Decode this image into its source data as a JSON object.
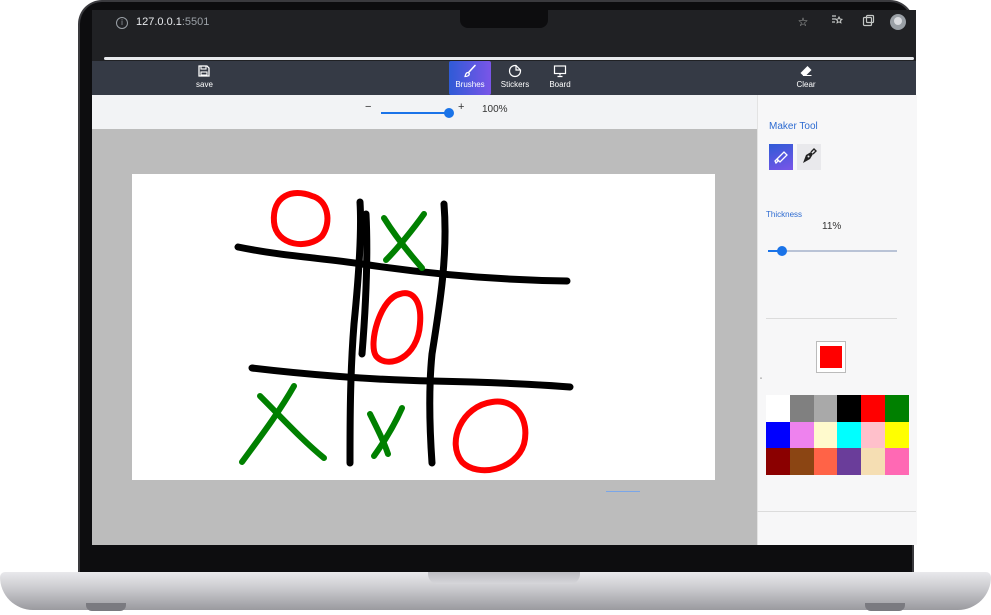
{
  "browser": {
    "url_host": "127.0.0.1",
    "url_port": ":5501",
    "icons": [
      "info-icon",
      "star-icon",
      "bookmarks-icon",
      "extensions-icon",
      "profile-avatar"
    ]
  },
  "toolbar": {
    "save_label": "save",
    "brushes_label": "Brushes",
    "stickers_label": "Stickers",
    "board_label": "Board",
    "clear_label": "Clear",
    "active_tab": "Brushes"
  },
  "zoom": {
    "minus": "−",
    "plus": "+",
    "value": "100%",
    "level": 1.0
  },
  "sidebar": {
    "title": "Maker Tool",
    "tools": [
      {
        "icon": "marker-icon",
        "active": true
      },
      {
        "icon": "pen-nib-icon",
        "active": false
      }
    ],
    "thickness_label": "Thickness",
    "thickness_value": "11%",
    "thickness_level": 0.11,
    "current_color": "#ff0000",
    "palette": [
      "#ffffff",
      "#808080",
      "#a9a9a9",
      "#000000",
      "#ff0000",
      "#008000",
      "#0000ff",
      "#ee82ee",
      "#fffacd",
      "#00ffff",
      "#ffc0cb",
      "#ffff00",
      "#8b0000",
      "#8b4513",
      "#ff6347",
      "#6a3d9a",
      "#f5deb3",
      "#ff69b4"
    ]
  },
  "drawing": {
    "grid_color": "#000000",
    "o_color": "#ff0000",
    "x_color": "#008000",
    "marks": [
      "O",
      "X",
      "",
      "",
      "O",
      "",
      "X",
      "X",
      "O"
    ]
  }
}
